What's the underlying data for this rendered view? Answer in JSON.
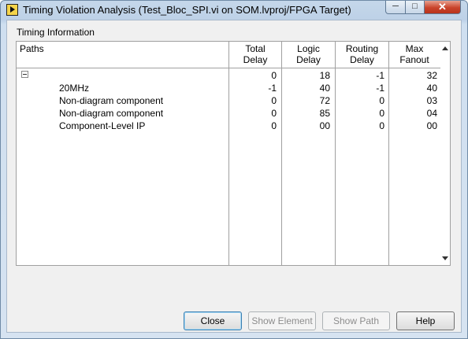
{
  "window": {
    "title": "Timing Violation Analysis (Test_Bloc_SPI.vi on SOM.lvproj/FPGA Target)",
    "app_icon": "labview-run-icon",
    "controls": {
      "minimize": "─",
      "maximize": "□",
      "close": "✕"
    }
  },
  "timing": {
    "group_label": "Timing Information",
    "headers": {
      "paths": "Paths",
      "total_delay": [
        "Total",
        "Delay"
      ],
      "logic_delay": [
        "Logic",
        "Delay"
      ],
      "routing_delay": [
        "Routing",
        "Delay"
      ],
      "max_fanout": [
        "Max",
        "Fanout"
      ]
    },
    "rows": [
      {
        "label": "",
        "total": "0",
        "logic": "18",
        "routing": "-1",
        "fanout": "32"
      },
      {
        "label": "20MHz",
        "total": "-1",
        "logic": "40",
        "routing": "-1",
        "fanout": "40"
      },
      {
        "label": "Non-diagram component",
        "total": "0",
        "logic": "72",
        "routing": "0",
        "fanout": "03"
      },
      {
        "label": "Non-diagram component",
        "total": "0",
        "logic": "85",
        "routing": "0",
        "fanout": "04"
      },
      {
        "label": "Component-Level IP",
        "total": "0",
        "logic": "00",
        "routing": "0",
        "fanout": "00"
      }
    ]
  },
  "buttons": {
    "close": "Close",
    "show_element": "Show Element",
    "show_path": "Show Path",
    "help": "Help"
  }
}
